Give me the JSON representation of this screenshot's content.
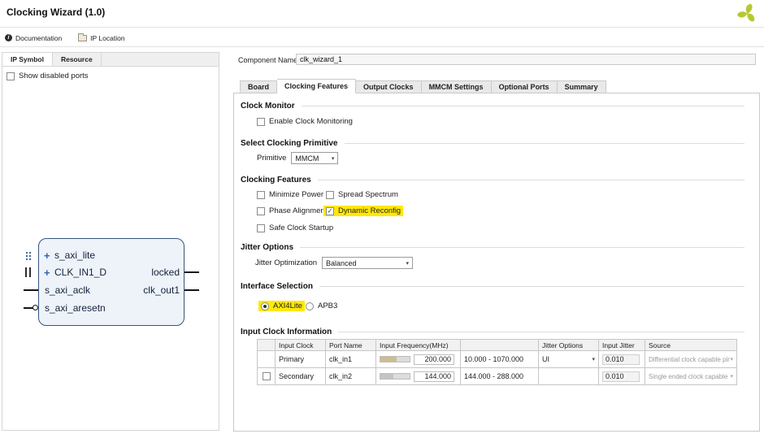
{
  "icons": {
    "chevron": "▾",
    "plus": "+",
    "info": "i",
    "check": "✓"
  },
  "colors": {
    "highlight_yellow": "#ffe80a",
    "logo_green": "#b6c832",
    "symbol_fill": "#eef3fa",
    "symbol_border": "#35557e"
  },
  "header": {
    "title": "Clocking Wizard (1.0)",
    "documentation": "Documentation",
    "ip_location": "IP Location"
  },
  "left_panel": {
    "tabs": [
      "IP Symbol",
      "Resource"
    ],
    "show_disabled_ports": "Show disabled ports",
    "symbol": {
      "input_ports": [
        "s_axi_lite",
        "CLK_IN1_D",
        "s_axi_aclk",
        "s_axi_aresetn"
      ],
      "output_ports": [
        "locked",
        "clk_out1"
      ]
    }
  },
  "main": {
    "component_name_label": "Component Name",
    "component_name_value": "clk_wizard_1",
    "tabs": [
      "Board",
      "Clocking Features",
      "Output Clocks",
      "MMCM Settings",
      "Optional Ports",
      "Summary"
    ],
    "active_tab": "Clocking Features",
    "clock_monitor": {
      "title": "Clock Monitor",
      "enable_label": "Enable Clock Monitoring"
    },
    "primitive": {
      "title": "Select Clocking Primitive",
      "label": "Primitive",
      "value": "MMCM"
    },
    "clocking_features": {
      "title": "Clocking Features",
      "options": [
        "Minimize Power",
        "Spread Spectrum",
        "Phase Alignment",
        "Dynamic Reconfig",
        "Safe Clock Startup"
      ],
      "checked_option": "Dynamic Reconfig"
    },
    "jitter": {
      "title": "Jitter Options",
      "label": "Jitter Optimization",
      "value": "Balanced"
    },
    "interface": {
      "title": "Interface Selection",
      "options": [
        "AXI4Lite",
        "APB3"
      ],
      "selected_option": "AXI4Lite"
    },
    "input_clocks": {
      "title": "Input Clock Information",
      "headers": [
        "Input Clock",
        "Port Name",
        "Input Frequency(MHz)",
        "",
        "Jitter Options",
        "Input Jitter",
        "Source"
      ],
      "rows": [
        {
          "input_clock": "Primary",
          "port_name": "clk_in1",
          "frequency": "200.000",
          "range": "10.000 - 1070.000",
          "jitter_options": "UI",
          "input_jitter": "0.010",
          "source": "Differential clock capable pin"
        },
        {
          "input_clock": "Secondary",
          "port_name": "clk_in2",
          "frequency": "144.000",
          "range": "144.000 - 288.000",
          "jitter_options": "",
          "input_jitter": "0.010",
          "source": "Single ended clock capable pin"
        }
      ]
    }
  }
}
